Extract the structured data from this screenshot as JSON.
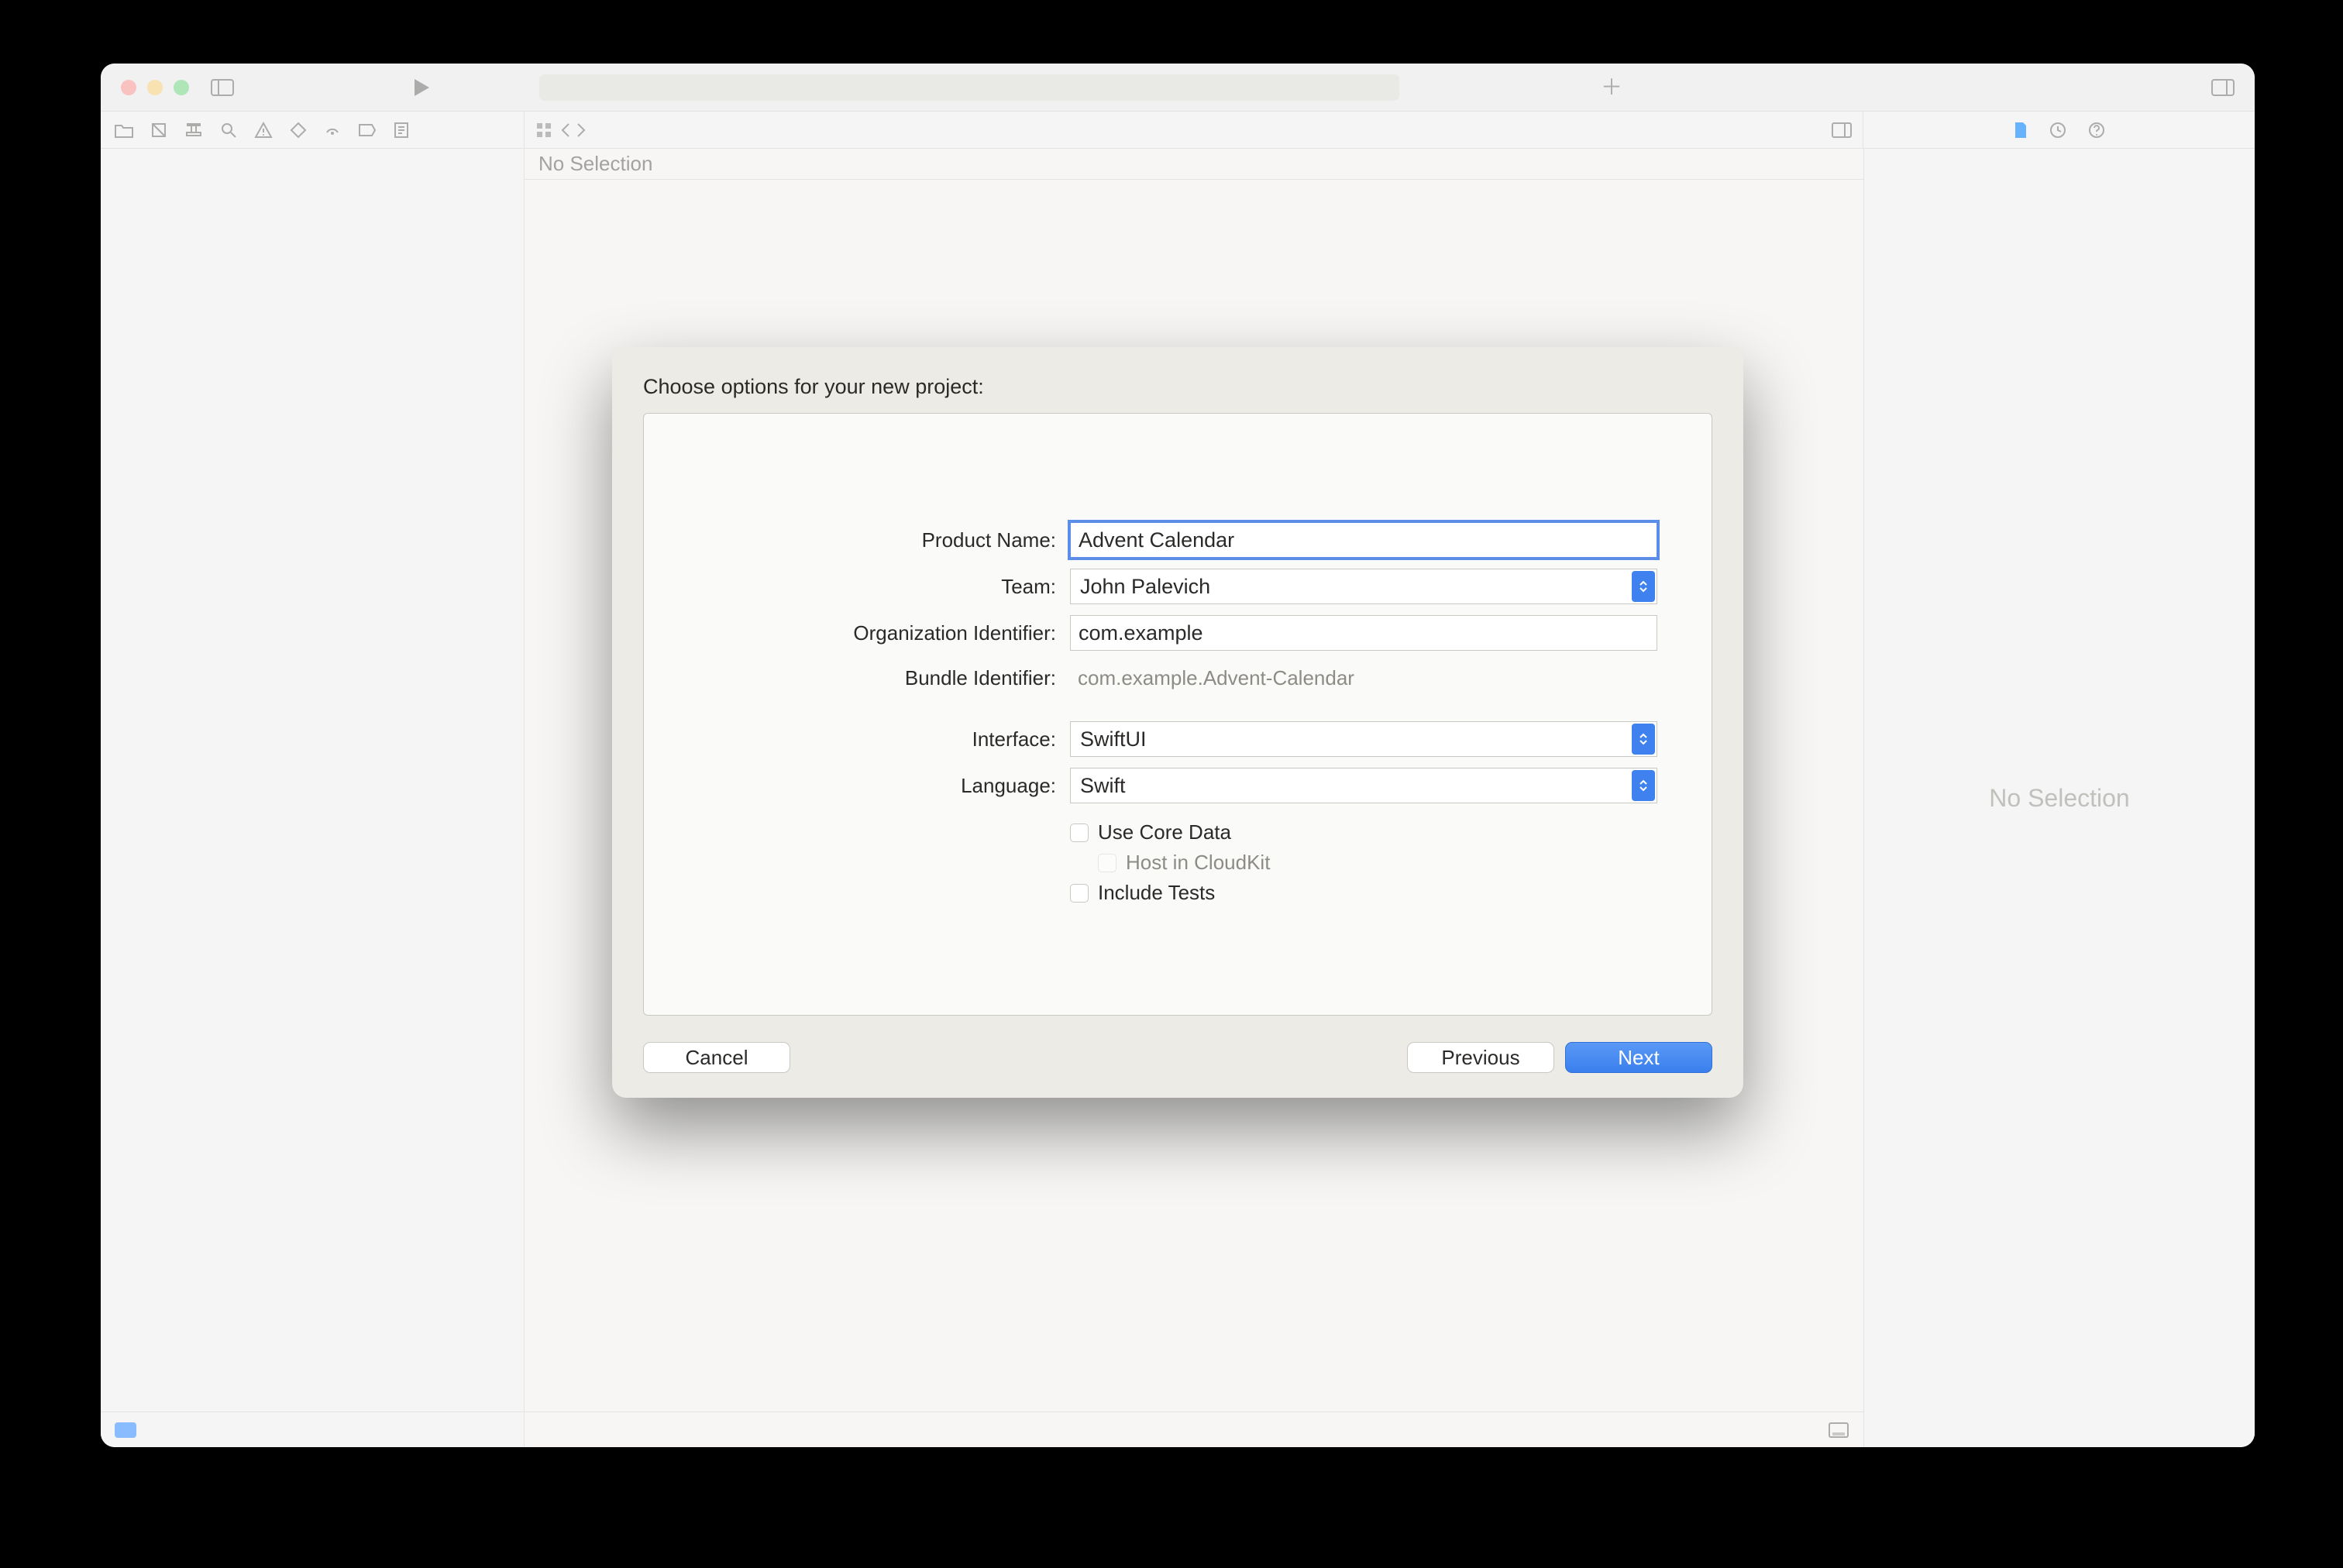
{
  "crumb": "No Selection",
  "inspector_placeholder": "No Selection",
  "sheet": {
    "title": "Choose options for your new project:",
    "labels": {
      "product_name": "Product Name:",
      "team": "Team:",
      "org_id": "Organization Identifier:",
      "bundle_id": "Bundle Identifier:",
      "interface": "Interface:",
      "language": "Language:"
    },
    "values": {
      "product_name": "Advent Calendar",
      "team": "John Palevich",
      "org_id": "com.example",
      "bundle_id": "com.example.Advent-Calendar",
      "interface": "SwiftUI",
      "language": "Swift"
    },
    "checkboxes": {
      "use_core_data": "Use Core Data",
      "host_cloudkit": "Host in CloudKit",
      "include_tests": "Include Tests"
    },
    "buttons": {
      "cancel": "Cancel",
      "previous": "Previous",
      "next": "Next"
    }
  }
}
